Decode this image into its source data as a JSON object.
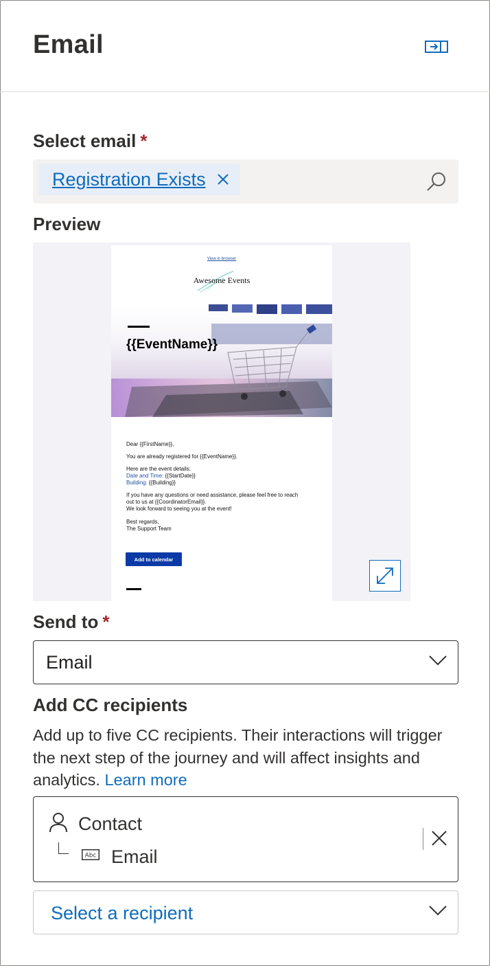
{
  "panel": {
    "title": "Email",
    "collapse_icon": "collapse-panel-icon"
  },
  "select_email": {
    "label": "Select email",
    "required_mark": "*",
    "selected_tag": "Registration Exists",
    "remove_icon": "close-icon",
    "search_icon": "search-icon"
  },
  "preview": {
    "label": "Preview",
    "email": {
      "view_in_browser": "View in browser",
      "brand": "Awesome Events",
      "hero_title": "{{EventName}}",
      "greeting": "Dear {{FirstName}},",
      "line1": "You are already registered for {{EventName}}.",
      "details_intro": "Here are the event details:",
      "date_label": "Date and Time:",
      "date_value": "{{StartDate}}",
      "building_label": "Building:",
      "building_value": "{{Building}}",
      "help_line1": "If you have any questions or need assistance, please feel free to reach",
      "help_line2": "out to us at {{CoordinatorEmail}}.",
      "help_line3": "We look forward to seeing you at the event!",
      "sign1": "Best regards,",
      "sign2": "The Support Team",
      "cta": "Add to calendar"
    },
    "expand_icon": "expand-icon"
  },
  "send_to": {
    "label": "Send to",
    "required_mark": "*",
    "value": "Email"
  },
  "cc": {
    "heading": "Add CC recipients",
    "description": "Add up to five CC recipients. Their interactions will trigger the next step of the journey and will affect insights and analytics.",
    "learn_more": "Learn more",
    "entity": "Contact",
    "field": "Email",
    "select_placeholder": "Select a recipient"
  },
  "colors": {
    "accent": "#0f6cbd",
    "required": "#a4262c",
    "cta": "#0b3aa7"
  }
}
